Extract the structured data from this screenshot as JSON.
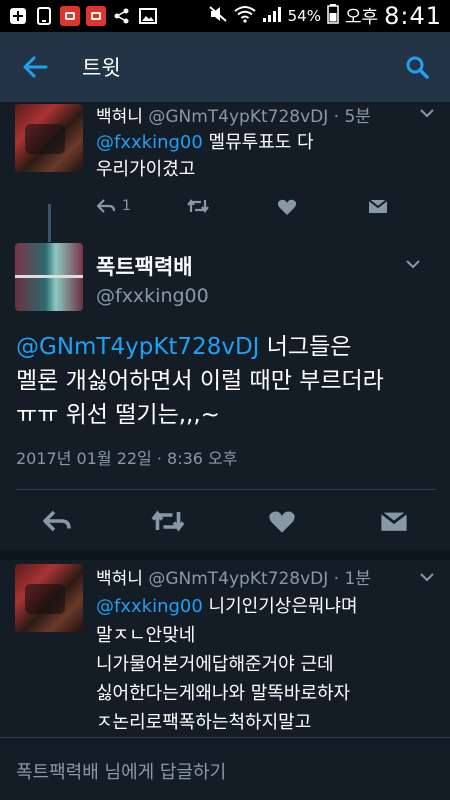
{
  "status_bar": {
    "battery": "54%",
    "ampm": "오후",
    "time": "8:41",
    "icons": [
      "plus-icon",
      "phone-icon",
      "app-red-1-icon",
      "app-red-2-icon",
      "share-icon",
      "image-icon",
      "mute-icon",
      "wifi-icon",
      "signal-icon",
      "battery-icon"
    ]
  },
  "app_bar": {
    "title": "트윗",
    "back_icon": "arrow-left-icon",
    "search_icon": "search-icon"
  },
  "tweets": {
    "prev": {
      "name": "백혀니",
      "handle": "@GNmT4ypKt728vDJ",
      "time": "· 5분",
      "reply_to": "@fxxking00",
      "line1_rest": " 멜뮤투표도 다",
      "line2": "우리가이겼고",
      "reply_count": "1"
    },
    "main": {
      "name": "폭트팩력배",
      "handle": "@fxxking00",
      "mention": "@GNmT4ypKt728vDJ",
      "line1_rest": " 너그들은",
      "line2": "멜론 개싫어하면서 이럴 때만 부르더라",
      "line3": "ㅠㅠ 위선 떨기는,,,~",
      "date": "2017년 01월 22일 · 8:36 오후"
    },
    "next": {
      "name": "백혀니",
      "handle": "@GNmT4ypKt728vDJ",
      "time": "· 1분",
      "reply_to": "@fxxking00",
      "line1_rest": " 니기인기상은뭐냐며",
      "line2": "말ㅈㄴ안맞네",
      "line3": "니가물어본거에답해준거야 근데",
      "line4": "싫어한다는게왜나와 말똑바로하자",
      "line5": "ㅈ논리로팩폭하는척하지말고"
    }
  },
  "reply_box": {
    "placeholder": "폭트팩력배 님에게 답글하기"
  },
  "colors": {
    "background": "#141d26",
    "app_bar": "#243447",
    "accent": "#1da1f2",
    "muted": "#8899a6"
  }
}
